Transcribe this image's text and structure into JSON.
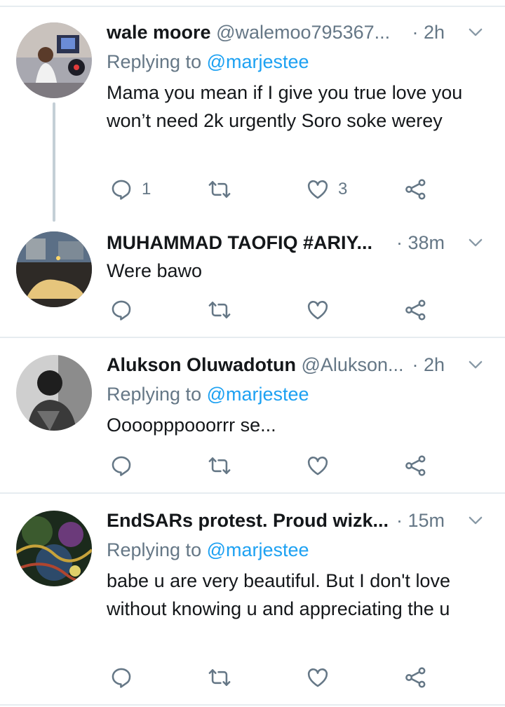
{
  "tweets": [
    {
      "name": "wale moore",
      "handle": "@walemoo795367...",
      "time": "· 2h",
      "replying_label": "Replying to ",
      "replying_to": "@marjestee",
      "text": "Mama you mean if I give you true love you won’t  need 2k urgently Soro soke werey",
      "reply_count": "1",
      "retweet_count": "",
      "like_count": "3"
    },
    {
      "name": "MUHAMMAD TAOFIQ #ARIY...",
      "handle": "",
      "time": "· 38m",
      "text": "Were bawo",
      "reply_count": "",
      "retweet_count": "",
      "like_count": ""
    },
    {
      "name": "Alukson Oluwadotun",
      "handle": "@Alukson...",
      "time": "· 2h",
      "replying_label": "Replying to ",
      "replying_to": "@marjestee",
      "text": "Oooopppooorrr se...",
      "reply_count": "",
      "retweet_count": "",
      "like_count": ""
    },
    {
      "name": "EndSARs protest. Proud wizk...",
      "handle": "",
      "time": "· 15m",
      "replying_label": "Replying to ",
      "replying_to": "@marjestee",
      "text": "babe u are very beautiful. But I don't love without knowing u and appreciating the u",
      "reply_count": "",
      "retweet_count": "",
      "like_count": ""
    }
  ],
  "icons": {
    "reply": "reply-icon",
    "retweet": "retweet-icon",
    "like": "heart-icon",
    "share": "share-icon",
    "menu": "chevron-down-icon"
  },
  "colors": {
    "text": "#14171a",
    "secondary": "#657786",
    "link": "#1da1f2",
    "separator": "#e6ecf0"
  }
}
